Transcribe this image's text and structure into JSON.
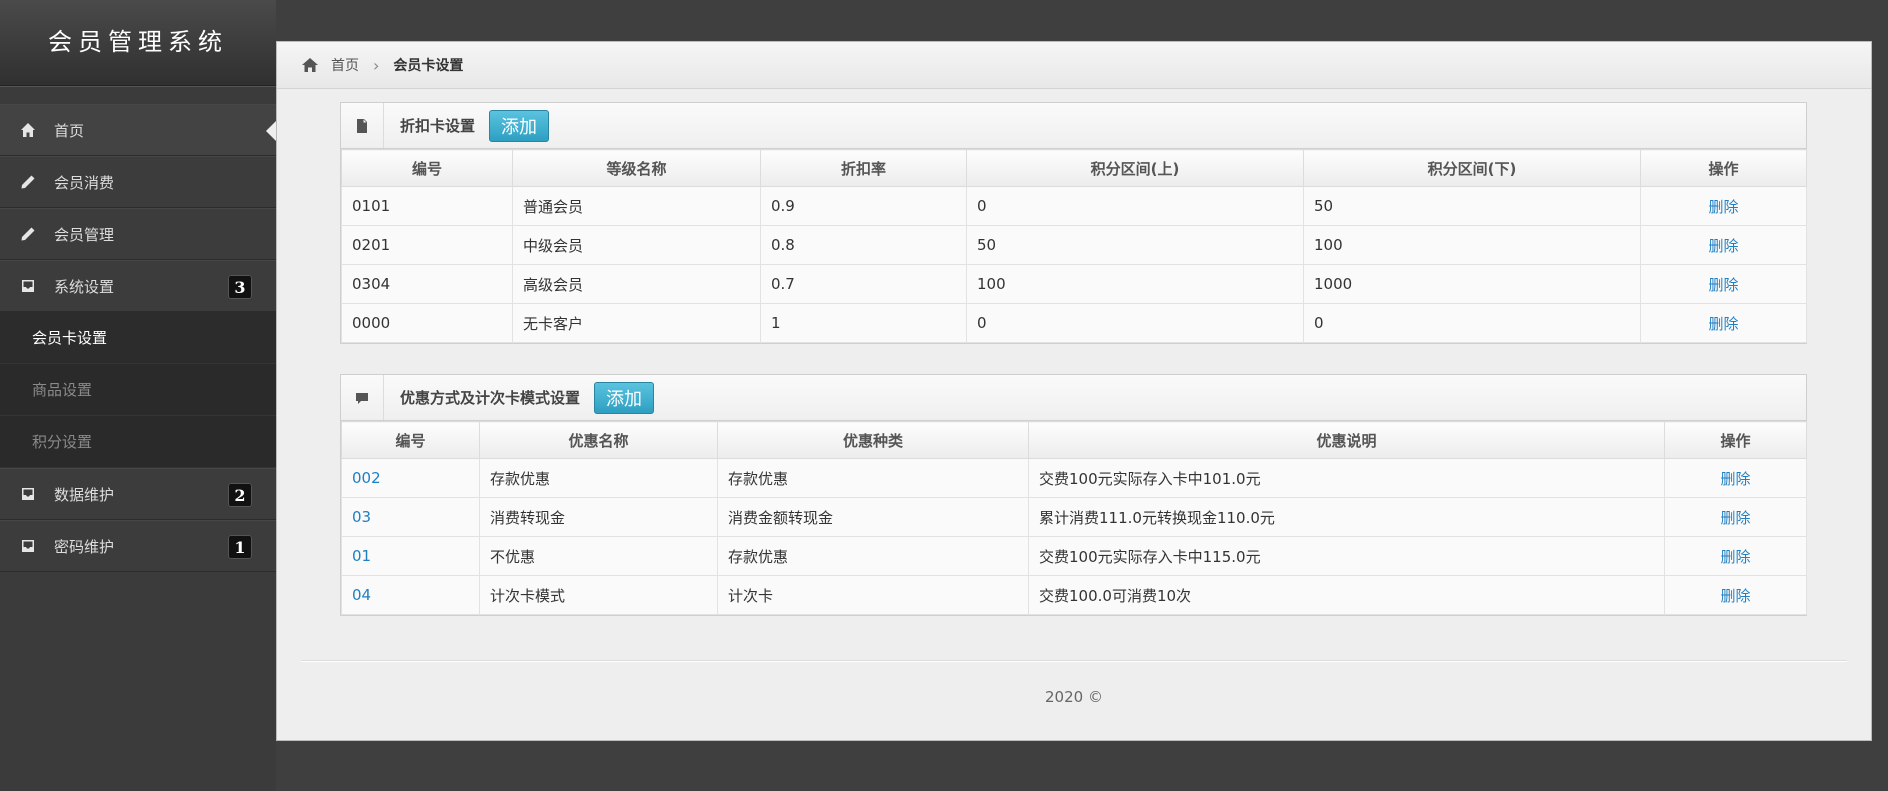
{
  "app": {
    "title": "会员管理系统"
  },
  "sidebar": {
    "items": [
      {
        "label": "首页",
        "icon": "home-icon"
      },
      {
        "label": "会员消费",
        "icon": "pencil-icon"
      },
      {
        "label": "会员管理",
        "icon": "pencil-icon"
      },
      {
        "label": "系统设置",
        "icon": "inbox-icon",
        "badge": "3"
      },
      {
        "label": "数据维护",
        "icon": "inbox-icon",
        "badge": "2"
      },
      {
        "label": "密码维护",
        "icon": "inbox-icon",
        "badge": "1"
      }
    ],
    "sub_items": [
      "会员卡设置",
      "商品设置",
      "积分设置"
    ]
  },
  "breadcrumb": {
    "home": "首页",
    "current": "会员卡设置"
  },
  "discount_panel": {
    "title": "折扣卡设置",
    "add_label": "添加",
    "columns": [
      "编号",
      "等级名称",
      "折扣率",
      "积分区间(上)",
      "积分区间(下)",
      "操作"
    ],
    "rows": [
      {
        "id": "0101",
        "name": "普通会员",
        "rate": "0.9",
        "upper": "0",
        "lower": "50",
        "action": "删除"
      },
      {
        "id": "0201",
        "name": "中级会员",
        "rate": "0.8",
        "upper": "50",
        "lower": "100",
        "action": "删除"
      },
      {
        "id": "0304",
        "name": "高级会员",
        "rate": "0.7",
        "upper": "100",
        "lower": "1000",
        "action": "删除"
      },
      {
        "id": "0000",
        "name": "无卡客户",
        "rate": "1",
        "upper": "0",
        "lower": "0",
        "action": "删除"
      }
    ]
  },
  "promo_panel": {
    "title": "优惠方式及计次卡模式设置",
    "add_label": "添加",
    "columns": [
      "编号",
      "优惠名称",
      "优惠种类",
      "优惠说明",
      "操作"
    ],
    "rows": [
      {
        "id": "002",
        "name": "存款优惠",
        "type": "存款优惠",
        "desc": "交费100元实际存入卡中101.0元",
        "action": "删除"
      },
      {
        "id": "03",
        "name": "消费转现金",
        "type": "消费金额转现金",
        "desc": "累计消费111.0元转换现金110.0元",
        "action": "删除"
      },
      {
        "id": "01",
        "name": "不优惠",
        "type": "存款优惠",
        "desc": "交费100元实际存入卡中115.0元",
        "action": "删除"
      },
      {
        "id": "04",
        "name": "计次卡模式",
        "type": "计次卡",
        "desc": "交费100.0可消费10次",
        "action": "删除"
      }
    ]
  },
  "footer": {
    "text": "2020 ©"
  },
  "colors": {
    "accent": "#2e9fc2",
    "link": "#1f7fc0",
    "sidebar_bg": "#3b3b3b"
  }
}
